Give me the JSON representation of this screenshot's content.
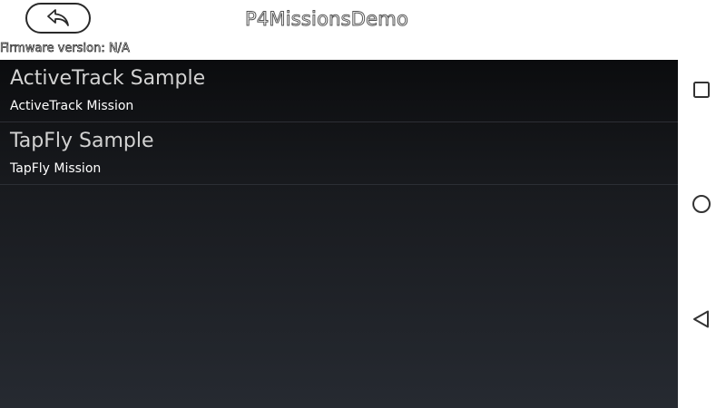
{
  "header": {
    "title": "P4MissionsDemo",
    "firmware_text": "Firmware version: N/A"
  },
  "icons": {
    "back": "back-arrow-icon",
    "recents": "square-icon",
    "home": "circle-icon",
    "nav_back": "triangle-back-icon"
  },
  "list": {
    "items": [
      {
        "title": "ActiveTrack Sample",
        "subtitle": "ActiveTrack Mission"
      },
      {
        "title": "TapFly Sample",
        "subtitle": "TapFly Mission"
      }
    ]
  },
  "colors": {
    "list_top": "#0b0c0e",
    "list_bottom": "#262a31",
    "item_title": "#d2d2d2",
    "item_subtitle": "#ffffff"
  }
}
